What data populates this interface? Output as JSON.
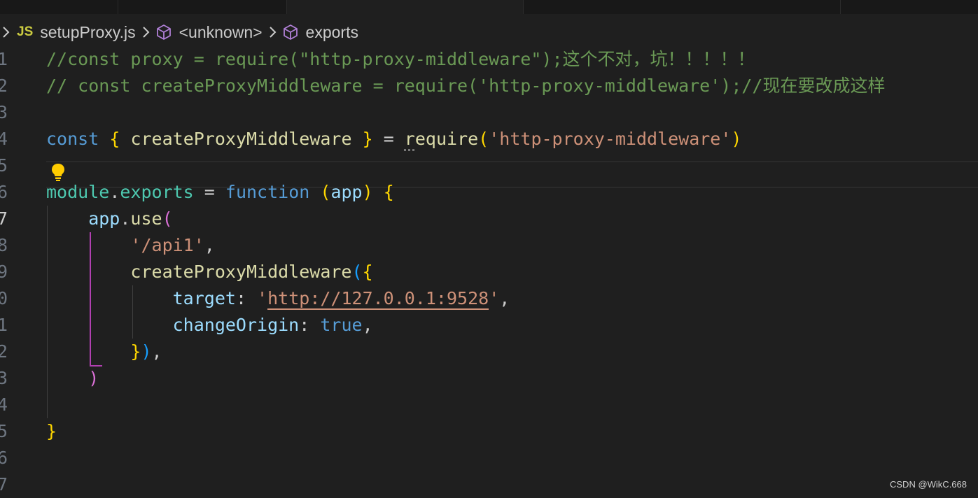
{
  "breadcrumb": {
    "file_badge": "JS",
    "file_name": "setupProxy.js",
    "symbol1": "<unknown>",
    "symbol2": "exports"
  },
  "lines": [
    {
      "num": "1",
      "tokens": [
        {
          "t": "//const proxy = require(\"http-proxy-middleware\");这个不对，坑！！！！！",
          "c": "comment"
        }
      ]
    },
    {
      "num": "2",
      "tokens": [
        {
          "t": "// const createProxyMiddleware = require('http-proxy-middleware');//现在要改成这样",
          "c": "comment"
        }
      ]
    },
    {
      "num": "3",
      "tokens": []
    },
    {
      "num": "4",
      "tokens": [
        {
          "t": "const",
          "c": "kw"
        },
        {
          "t": " ",
          "c": "punc"
        },
        {
          "t": "{",
          "c": "brace1"
        },
        {
          "t": " createProxyMiddleware ",
          "c": "fn"
        },
        {
          "t": "}",
          "c": "brace1"
        },
        {
          "t": " = ",
          "c": "punc"
        },
        {
          "t": "r",
          "c": "fn dots"
        },
        {
          "t": "equire",
          "c": "fn"
        },
        {
          "t": "(",
          "c": "brace1"
        },
        {
          "t": "'http-proxy-middleware'",
          "c": "str"
        },
        {
          "t": ")",
          "c": "brace1"
        }
      ]
    },
    {
      "num": "5",
      "tokens": []
    },
    {
      "num": "6",
      "tokens": [
        {
          "t": "module",
          "c": "obj"
        },
        {
          "t": ".",
          "c": "punc"
        },
        {
          "t": "exports",
          "c": "obj"
        },
        {
          "t": " = ",
          "c": "punc"
        },
        {
          "t": "function",
          "c": "kw"
        },
        {
          "t": " ",
          "c": "punc"
        },
        {
          "t": "(",
          "c": "brace1"
        },
        {
          "t": "app",
          "c": "var"
        },
        {
          "t": ")",
          "c": "brace1"
        },
        {
          "t": " ",
          "c": "punc"
        },
        {
          "t": "{",
          "c": "brace1"
        }
      ]
    },
    {
      "num": "7",
      "tokens": [
        {
          "t": "    app",
          "c": "var"
        },
        {
          "t": ".",
          "c": "punc"
        },
        {
          "t": "use",
          "c": "fn"
        },
        {
          "t": "(",
          "c": "brace2"
        }
      ]
    },
    {
      "num": "8",
      "tokens": [
        {
          "t": "        ",
          "c": "punc"
        },
        {
          "t": "'/api1'",
          "c": "str"
        },
        {
          "t": ",",
          "c": "punc"
        }
      ]
    },
    {
      "num": "9",
      "tokens": [
        {
          "t": "        createProxyMiddleware",
          "c": "fn"
        },
        {
          "t": "(",
          "c": "brace3"
        },
        {
          "t": "{",
          "c": "brace1"
        }
      ]
    },
    {
      "num": "0",
      "tokens": [
        {
          "t": "            target",
          "c": "var"
        },
        {
          "t": ": ",
          "c": "punc"
        },
        {
          "t": "'",
          "c": "str"
        },
        {
          "t": "http://127.0.0.1:9528",
          "c": "str url-ul"
        },
        {
          "t": "'",
          "c": "str"
        },
        {
          "t": ",",
          "c": "punc"
        }
      ]
    },
    {
      "num": "1",
      "tokens": [
        {
          "t": "            changeOrigin",
          "c": "var"
        },
        {
          "t": ": ",
          "c": "punc"
        },
        {
          "t": "true",
          "c": "bool"
        },
        {
          "t": ",",
          "c": "punc"
        }
      ]
    },
    {
      "num": "2",
      "tokens": [
        {
          "t": "        ",
          "c": "punc"
        },
        {
          "t": "}",
          "c": "brace1"
        },
        {
          "t": ")",
          "c": "brace3"
        },
        {
          "t": ",",
          "c": "punc"
        }
      ]
    },
    {
      "num": "3",
      "tokens": [
        {
          "t": "    ",
          "c": "punc"
        },
        {
          "t": ")",
          "c": "brace2"
        }
      ]
    },
    {
      "num": "4",
      "tokens": []
    },
    {
      "num": "5",
      "tokens": [
        {
          "t": "}",
          "c": "brace1"
        }
      ]
    },
    {
      "num": "6",
      "tokens": []
    },
    {
      "num": "7",
      "tokens": []
    }
  ],
  "current_line_index": 6,
  "watermark": "CSDN @WikC.668",
  "colors": {
    "background": "#1f1f1f",
    "comment": "#6a9955",
    "keyword": "#569cd6",
    "string": "#ce9178",
    "function": "#dcdcaa",
    "variable": "#9cdcfe"
  },
  "icons": {
    "breadcrumb_separator": "chevron-right-icon",
    "symbol": "cube-icon",
    "lightbulb": "lightbulb-icon"
  }
}
